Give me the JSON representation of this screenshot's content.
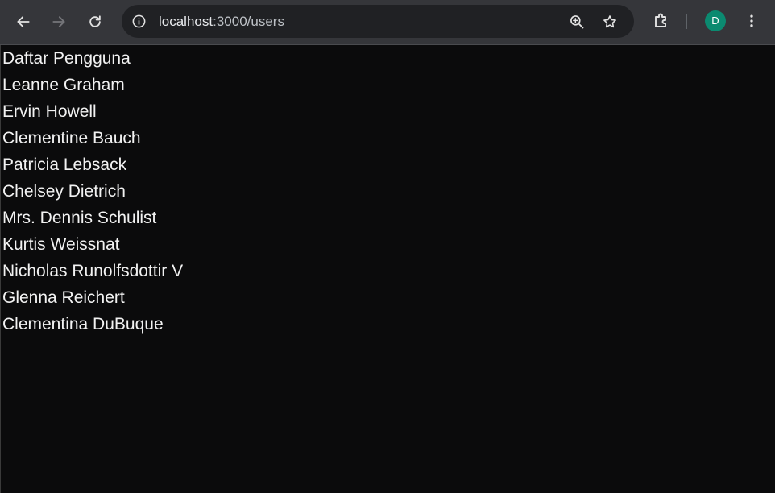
{
  "browser": {
    "url_host": "localhost",
    "url_path": ":3000/users",
    "profile_initial": "D"
  },
  "page": {
    "heading": "Daftar Pengguna",
    "users": [
      "Leanne Graham",
      "Ervin Howell",
      "Clementine Bauch",
      "Patricia Lebsack",
      "Chelsey Dietrich",
      "Mrs. Dennis Schulist",
      "Kurtis Weissnat",
      "Nicholas Runolfsdottir V",
      "Glenna Reichert",
      "Clementina DuBuque"
    ]
  },
  "icons": {
    "back": "back-arrow-icon",
    "forward": "forward-arrow-icon",
    "reload": "reload-icon",
    "site_info": "info-icon",
    "zoom": "zoom-in-icon",
    "bookmark": "star-icon",
    "extensions": "puzzle-icon",
    "menu": "kebab-menu-icon"
  },
  "colors": {
    "toolbar": "#35363a",
    "omnibox": "#202124",
    "page_background": "#0b0b0c",
    "avatar": "#0b8a70",
    "text": "#f2f2f2"
  }
}
